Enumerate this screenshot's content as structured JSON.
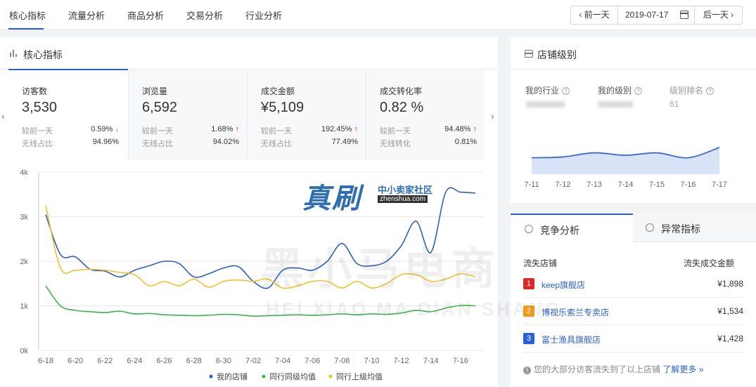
{
  "nav": {
    "tabs": [
      {
        "label": "核心指标"
      },
      {
        "label": "流量分析"
      },
      {
        "label": "商品分析"
      },
      {
        "label": "交易分析"
      },
      {
        "label": "行业分析"
      }
    ],
    "prev_label": "‹ 前一天",
    "date": "2019-07-17",
    "next_label": "后一天 ›"
  },
  "core": {
    "title": "核心指标",
    "metrics": [
      {
        "label": "访客数",
        "value": "3,530",
        "row1_label": "较前一天",
        "row1_value": "0.59%",
        "row1_arrow": "↓",
        "row2_label": "无线占比",
        "row2_value": "94.96%"
      },
      {
        "label": "浏览量",
        "value": "6,592",
        "row1_label": "较前一天",
        "row1_value": "1.68%",
        "row1_arrow": "↑",
        "row2_label": "无线占比",
        "row2_value": "94.02%"
      },
      {
        "label": "成交金额",
        "value": "¥5,109",
        "row1_label": "较前一天",
        "row1_value": "192.45%",
        "row1_arrow": "↑",
        "row2_label": "无线占比",
        "row2_value": "77.49%"
      },
      {
        "label": "成交转化率",
        "value": "0.82 %",
        "row1_label": "较前一天",
        "row1_value": "94.48%",
        "row1_arrow": "↑",
        "row2_label": "无线转化",
        "row2_value": "0.81%"
      }
    ],
    "pager_prev": "‹",
    "pager_next": "›"
  },
  "chart_data": {
    "type": "line",
    "yticks": [
      "0k",
      "1k",
      "2k",
      "3k",
      "4k"
    ],
    "ylim": [
      0,
      4000
    ],
    "x": [
      "6-18",
      "6-19",
      "6-20",
      "6-21",
      "6-22",
      "6-23",
      "6-24",
      "6-25",
      "6-26",
      "6-27",
      "6-28",
      "6-29",
      "6-30",
      "7-01",
      "7-02",
      "7-03",
      "7-04",
      "7-05",
      "7-06",
      "7-07",
      "7-08",
      "7-09",
      "7-10",
      "7-11",
      "7-12",
      "7-13",
      "7-14",
      "7-15",
      "7-16",
      "7-17"
    ],
    "xticks": [
      "6-18",
      "6-20",
      "6-22",
      "6-24",
      "6-26",
      "6-28",
      "6-30",
      "7-02",
      "7-04",
      "7-06",
      "7-08",
      "7-10",
      "7-12",
      "7-14",
      "7-16"
    ],
    "series": [
      {
        "name": "我的店铺",
        "color": "#2f5fc4",
        "values": [
          3050,
          2150,
          2100,
          1820,
          1780,
          1650,
          1800,
          1900,
          2000,
          1950,
          1650,
          1720,
          1850,
          1880,
          1550,
          1400,
          1800,
          1850,
          1800,
          2000,
          2400,
          1950,
          1900,
          2000,
          2350,
          2900,
          2200,
          3550,
          3550,
          3530
        ]
      },
      {
        "name": "同行同级均值",
        "color": "#3cb44b",
        "values": [
          1450,
          1000,
          900,
          870,
          850,
          880,
          820,
          830,
          800,
          790,
          780,
          790,
          810,
          800,
          770,
          780,
          790,
          800,
          790,
          800,
          820,
          800,
          820,
          810,
          840,
          900,
          870,
          950,
          1010,
          1000
        ]
      },
      {
        "name": "同行上级均值",
        "color": "#f2c12e",
        "values": [
          3250,
          1850,
          1800,
          1820,
          1800,
          1750,
          1700,
          1450,
          1550,
          1450,
          1600,
          1420,
          1550,
          1580,
          1550,
          1600,
          1400,
          1450,
          1550,
          1550,
          1400,
          1550,
          1400,
          1500,
          1700,
          1700,
          1550,
          1600,
          1720,
          1650
        ]
      }
    ]
  },
  "shop_level": {
    "title": "店铺级别",
    "industry_label": "我的行业",
    "level_label": "我的级别",
    "rank_label": "级别排名",
    "rank_value": "61",
    "mini_chart": {
      "x": [
        "7-11",
        "7-12",
        "7-13",
        "7-14",
        "7-15",
        "7-16",
        "7-17"
      ],
      "values": [
        40,
        42,
        52,
        46,
        52,
        40,
        65
      ],
      "color": "#3a6bd0"
    }
  },
  "competition": {
    "tab_active": "竞争分析",
    "tab_other": "异常指标",
    "col_shop": "流失店铺",
    "col_amount": "流失成交金额",
    "rows": [
      {
        "rank": "1",
        "name": "keep旗舰店",
        "amount": "¥1,898",
        "color": "#d9282b"
      },
      {
        "rank": "2",
        "name": "博视乐索兰专卖店",
        "amount": "¥1,534",
        "color": "#f29a1a"
      },
      {
        "rank": "3",
        "name": "富士渔具旗舰店",
        "amount": "¥1,428",
        "color": "#2a5fd6"
      }
    ],
    "footer_text": "您的大部分访客流失到了以上店铺",
    "footer_link": "了解更多 »"
  },
  "watermark": {
    "brand_cn": "真刷",
    "brand_sub": "中小卖家社区",
    "brand_url": "zhenshua.com",
    "big_text": "黑小马电商",
    "pinyin": "HEI XIAO MA DIAN SHANG"
  }
}
